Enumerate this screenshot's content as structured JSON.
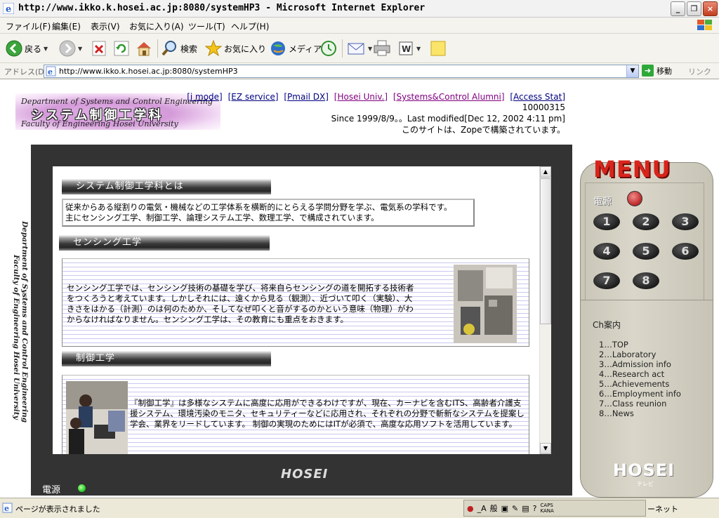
{
  "window": {
    "title": "http://www.ikko.k.hosei.ac.jp:8080/systemHP3 - Microsoft Internet Explorer"
  },
  "menubar": {
    "items": [
      "ファイル(F)",
      "編集(E)",
      "表示(V)",
      "お気に入り(A)",
      "ツール(T)",
      "ヘルプ(H)"
    ]
  },
  "toolbar": {
    "back": "戻る",
    "search": "検索",
    "favorites": "お気に入り",
    "media": "メディア"
  },
  "address": {
    "label": "アドレス(D)",
    "url": "http://www.ikko.k.hosei.ac.jp:8080/systemHP3",
    "go": "移動",
    "links": "リンク"
  },
  "header": {
    "logo_line1": "Department of Systems and Control Engineering",
    "logo_line2": "システム制御工学科",
    "logo_line3": "Faculty of Engineering Hosei University",
    "links": [
      "[i mode]",
      "[EZ service]",
      "[Pmail DX]",
      "[Hosei Univ.]",
      "[Systems&Control Alumni]",
      "[Access Stat]"
    ],
    "counter": "10000315",
    "since": "Since 1999/8/9。。Last modified[Dec 12, 2002 4:11 pm]",
    "zope": "このサイトは、Zopeで構築されています。"
  },
  "side_vertical": {
    "line1": "Department of Systems and Control Engineering",
    "line2": "Faculty of Engineering Hosei University"
  },
  "sections": [
    {
      "heading": "システム制御工学科とは",
      "text1": "従来からある縦割りの電気・機械などの工学体系を横断的にとらえる学問分野を学ぶ、電気系の学科です。",
      "text2": "主にセンシング工学、制御工学、論理システム工学、数理工学、で構成されています。"
    },
    {
      "heading": "センシング工学",
      "text": "センシング工学では、センシング技術の基礎を学び、将来自らセンシングの道を開拓する技術者をつくろうと考えています。しかしそれには、遠くから見る（観測）、近づいて叩く（実験）、大きさをはかる（計測）のは何のためか、そしてなぜ叩くと音がするのかという意味（物理）がわからなければなりません。センシング工学は、その教育にも重点をおきます。"
    },
    {
      "heading": "制御工学",
      "text": "『制御工学』は多様なシステムに高度に応用ができるわけですが、現在、カーナビを含むITS、高齢者介護支援システム、環境汚染のモニタ、セキュリティーなどに応用され、それぞれの分野で斬新なシステムを提案し学会、業界をリードしています。 制御の実現のためにはITが必須で、高度な応用ソフトを活用しています。"
    }
  ],
  "tv": {
    "brand": "HOSEI",
    "power_label": "電源"
  },
  "remote": {
    "title": "MENU",
    "power_label": "電源",
    "buttons": [
      "1",
      "2",
      "3",
      "4",
      "5",
      "6",
      "7",
      "8"
    ],
    "guide_title": "Ch案内",
    "channels": [
      "1…TOP",
      "2…Laboratory",
      "3…Admission info",
      "4…Research act",
      "5…Achievements",
      "6…Employment info",
      "7…Class reunion",
      "8…News"
    ],
    "brand": "HOSEI",
    "brand_sub": "テレビ"
  },
  "status": {
    "text": "ページが表示されました",
    "ime_mode": "般",
    "ime_caps": "CAPS",
    "ime_kana": "KANA",
    "zone": "ーネット"
  }
}
